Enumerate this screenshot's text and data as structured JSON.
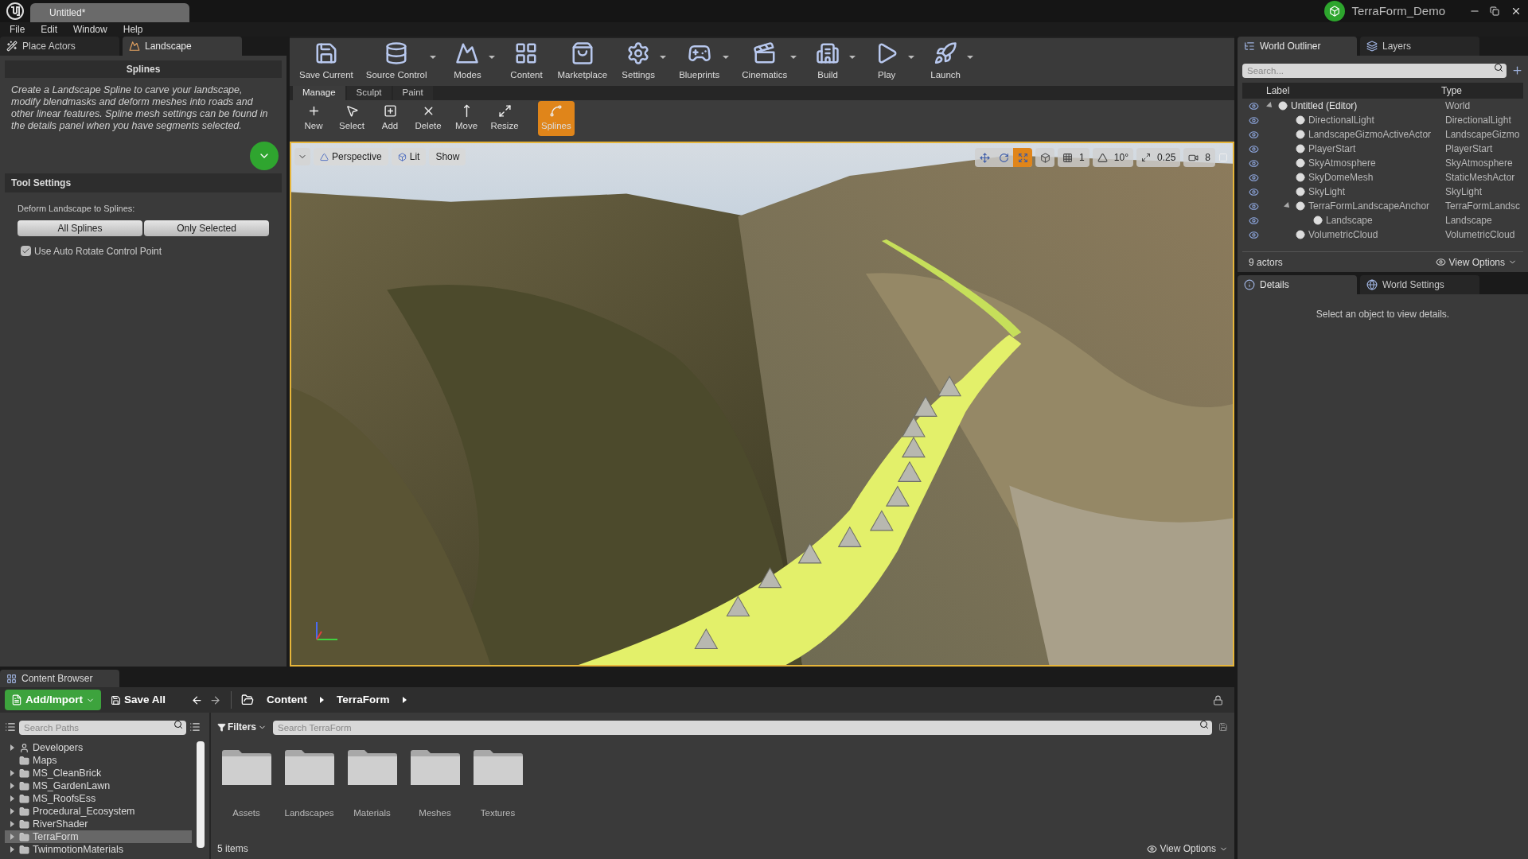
{
  "title_bar": {
    "tab": "Untitled*",
    "project": "TerraForm_Demo"
  },
  "menu": [
    "File",
    "Edit",
    "Window",
    "Help"
  ],
  "left_panel": {
    "tabs": [
      {
        "label": "Place Actors",
        "kind": "place",
        "selected": false
      },
      {
        "label": "Landscape",
        "kind": "landscape",
        "selected": true
      }
    ],
    "section_title": "Splines",
    "description": "Create a Landscape Spline to carve your landscape, modify blendmasks and deform meshes into roads and other linear features.  Spline mesh settings can be found in the details panel when you have  segments selected.",
    "tool_settings": {
      "title": "Tool Settings",
      "deform_label": "Deform Landscape to Splines:",
      "buttons": [
        "All Splines",
        "Only Selected"
      ],
      "checkbox": {
        "label": "Use Auto Rotate Control Point",
        "checked": true
      }
    }
  },
  "toolbar": [
    {
      "label": "Save Current",
      "kind": "save",
      "dropdown": false
    },
    {
      "label": "Source Control",
      "kind": "source_control",
      "dropdown": true
    },
    {
      "label": "Modes",
      "kind": "modes",
      "dropdown": true
    },
    {
      "label": "Content",
      "kind": "content",
      "dropdown": false
    },
    {
      "label": "Marketplace",
      "kind": "marketplace",
      "dropdown": false
    },
    {
      "label": "Settings",
      "kind": "settings",
      "dropdown": true
    },
    {
      "label": "Blueprints",
      "kind": "blueprints",
      "dropdown": true
    },
    {
      "label": "Cinematics",
      "kind": "cinematics",
      "dropdown": true
    },
    {
      "label": "Build",
      "kind": "build",
      "dropdown": true
    },
    {
      "label": "Play",
      "kind": "play",
      "dropdown": true
    },
    {
      "label": "Launch",
      "kind": "launch",
      "dropdown": true
    }
  ],
  "mode_tabs": [
    {
      "label": "Manage",
      "selected": true
    },
    {
      "label": "Sculpt",
      "selected": false
    },
    {
      "label": "Paint",
      "selected": false
    }
  ],
  "mode_tools": [
    {
      "label": "New",
      "kind": "new",
      "selected": false
    },
    {
      "label": "Select",
      "kind": "select",
      "selected": false
    },
    {
      "label": "Add",
      "kind": "add",
      "selected": false
    },
    {
      "label": "Delete",
      "kind": "delete",
      "selected": false
    },
    {
      "label": "Move",
      "kind": "move",
      "selected": false
    },
    {
      "label": "Resize",
      "kind": "resize",
      "selected": false
    },
    {
      "label": "Splines",
      "kind": "splines",
      "selected": true
    }
  ],
  "viewport": {
    "view_buttons": [
      {
        "label": "Perspective",
        "kind": "perspective"
      },
      {
        "label": "Lit",
        "kind": "lit"
      },
      {
        "label": "Show",
        "kind": "show"
      }
    ],
    "transform_tools": [
      {
        "kind": "move",
        "selected": false
      },
      {
        "kind": "rotate",
        "selected": false
      },
      {
        "kind": "scale",
        "selected": true
      }
    ],
    "grid_snap": "1",
    "rotation_snap": "10°",
    "scale_snap": "0.25",
    "camera_speed": "8"
  },
  "outliner": {
    "tabs": [
      {
        "label": "World Outliner",
        "kind": "outliner",
        "selected": true
      },
      {
        "label": "Layers",
        "kind": "layers",
        "selected": false
      }
    ],
    "search_placeholder": "Search...",
    "columns": [
      "Label",
      "Type"
    ],
    "rows": [
      {
        "label": "Untitled (Editor)",
        "type": "World",
        "expanded": true,
        "children": [
          {
            "label": "DirectionalLight",
            "type": "DirectionalLight"
          },
          {
            "label": "LandscapeGizmoActiveActor",
            "type": "LandscapeGizmo"
          },
          {
            "label": "PlayerStart",
            "type": "PlayerStart"
          },
          {
            "label": "SkyAtmosphere",
            "type": "SkyAtmosphere"
          },
          {
            "label": "SkyDomeMesh",
            "type": "StaticMeshActor"
          },
          {
            "label": "SkyLight",
            "type": "SkyLight"
          },
          {
            "label": "TerraFormLandscapeAnchor",
            "type": "TerraFormLandsc",
            "expanded": true,
            "children": [
              {
                "label": "Landscape",
                "type": "Landscape"
              }
            ]
          },
          {
            "label": "VolumetricCloud",
            "type": "VolumetricCloud"
          }
        ]
      }
    ],
    "actor_count": "9 actors",
    "view_options": "View Options"
  },
  "details": {
    "tabs": [
      {
        "label": "Details",
        "kind": "details",
        "selected": true
      },
      {
        "label": "World Settings",
        "kind": "world",
        "selected": false
      }
    ],
    "message": "Select an object to view details."
  },
  "content_browser": {
    "tab": "Content Browser",
    "add_import": "Add/Import",
    "save_all": "Save All",
    "breadcrumb": [
      "Content",
      "TerraForm"
    ],
    "search_paths_placeholder": "Search Paths",
    "filters": "Filters",
    "search_placeholder": "Search TerraForm",
    "tree": [
      {
        "label": "Developers",
        "kind": "user",
        "expandable": true,
        "selected": false
      },
      {
        "label": "Maps",
        "kind": "folder",
        "expandable": false,
        "selected": false
      },
      {
        "label": "MS_CleanBrick",
        "kind": "folder",
        "expandable": true,
        "selected": false
      },
      {
        "label": "MS_GardenLawn",
        "kind": "folder",
        "expandable": true,
        "selected": false
      },
      {
        "label": "MS_RoofsEss",
        "kind": "folder",
        "expandable": true,
        "selected": false
      },
      {
        "label": "Procedural_Ecosystem",
        "kind": "folder",
        "expandable": true,
        "selected": false
      },
      {
        "label": "RiverShader",
        "kind": "folder",
        "expandable": true,
        "selected": false
      },
      {
        "label": "TerraForm",
        "kind": "folder",
        "expandable": true,
        "selected": true
      },
      {
        "label": "TwinmotionMaterials",
        "kind": "folder",
        "expandable": true,
        "selected": false
      }
    ],
    "assets": [
      "Assets",
      "Landscapes",
      "Materials",
      "Meshes",
      "Textures"
    ],
    "item_count": "5 items",
    "view_options": "View Options"
  }
}
